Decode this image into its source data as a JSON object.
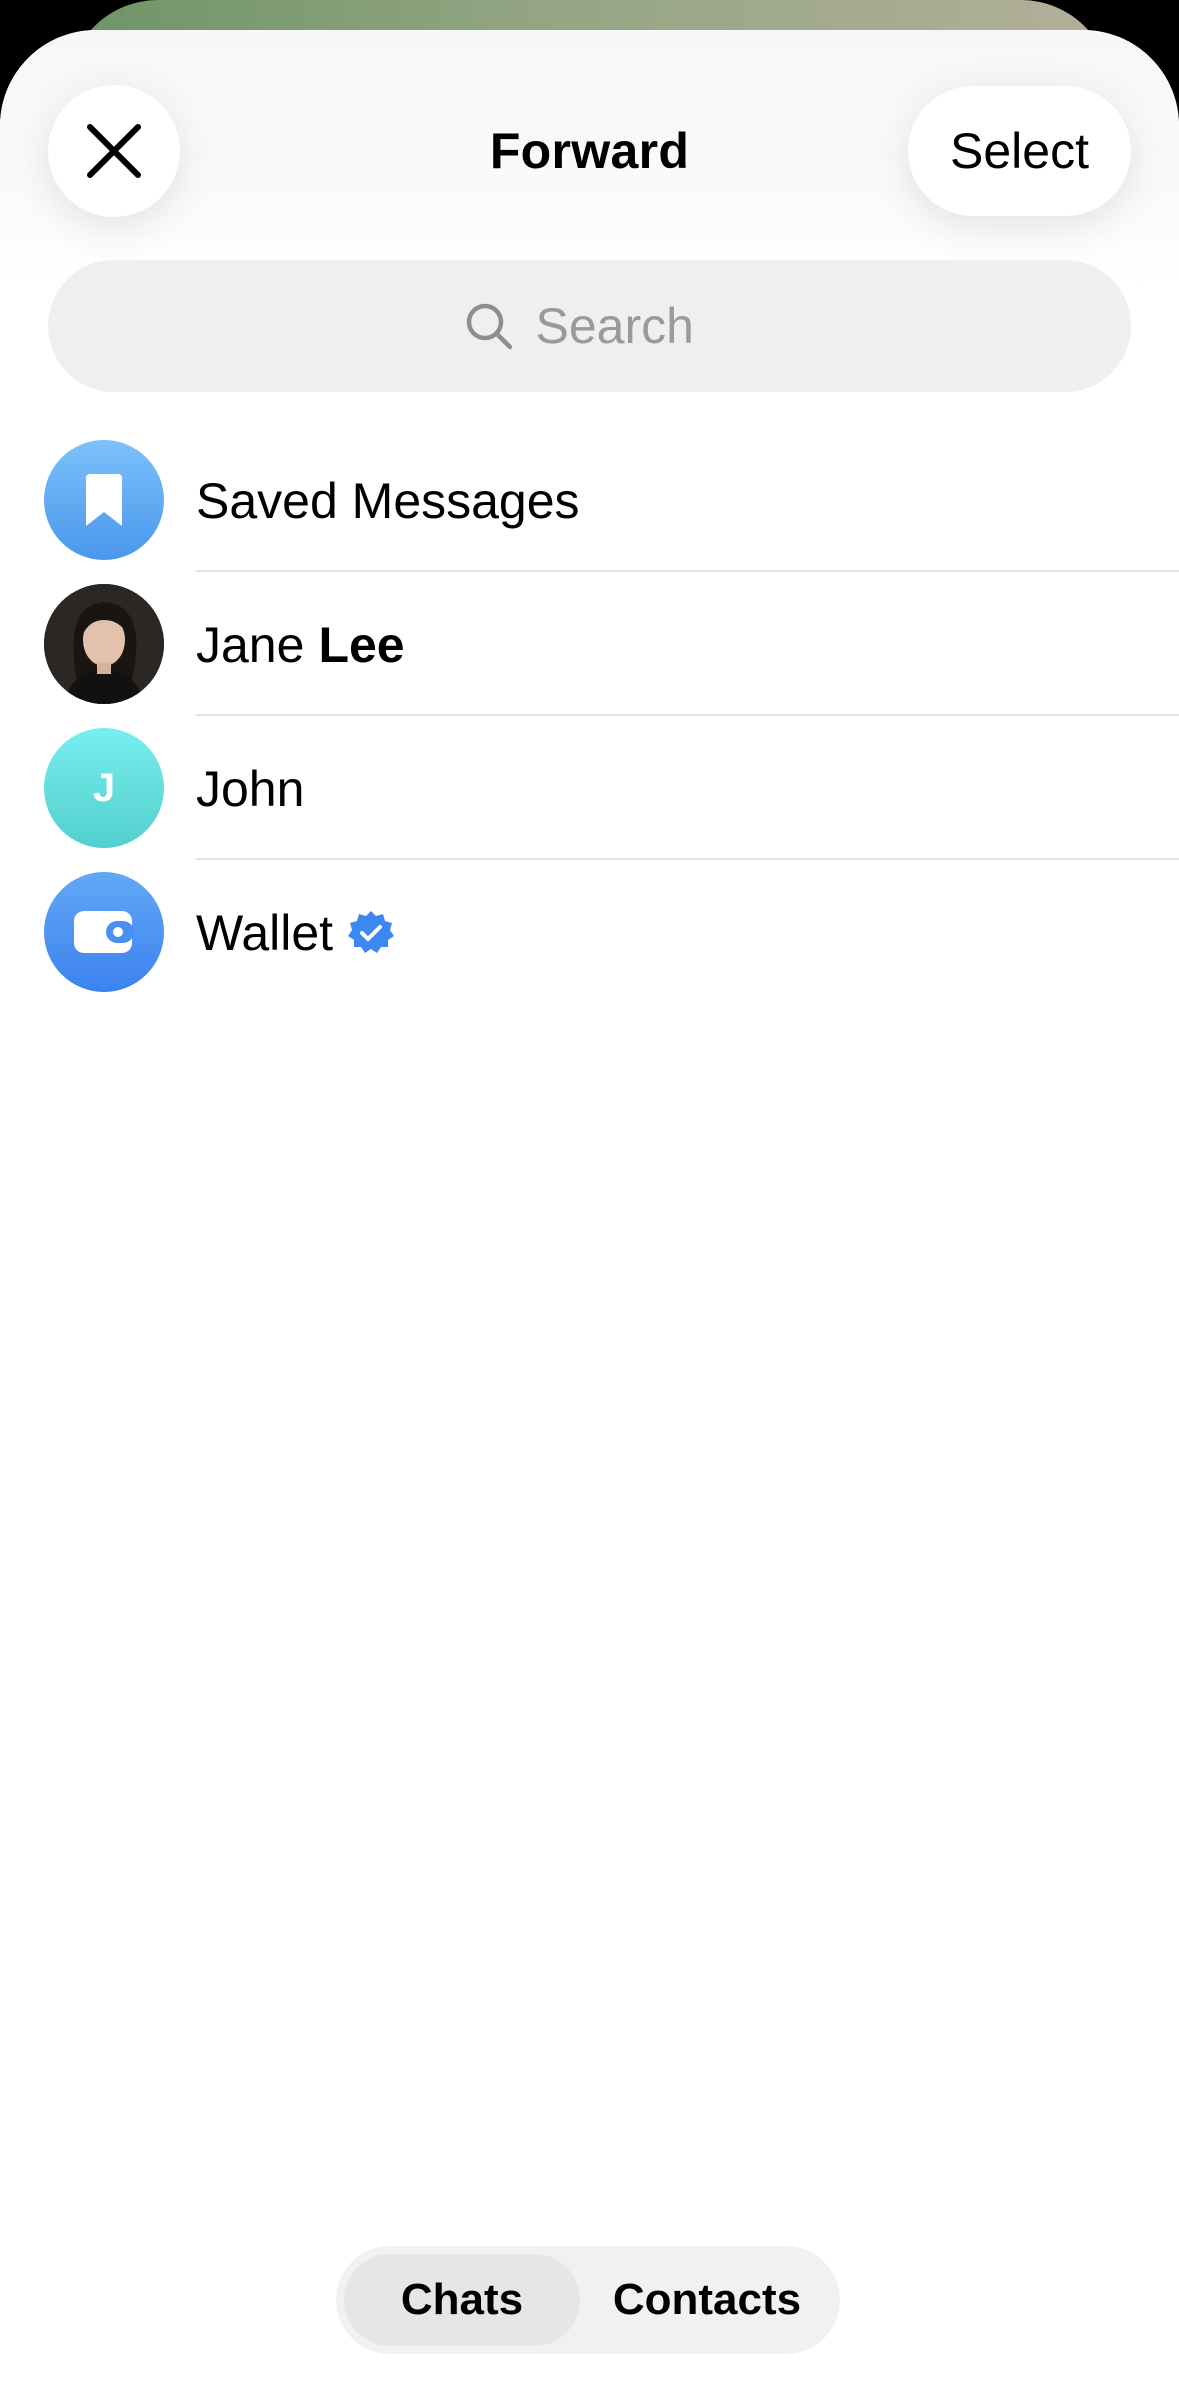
{
  "header": {
    "title": "Forward",
    "select_label": "Select"
  },
  "search": {
    "placeholder": "Search"
  },
  "chats": [
    {
      "name": "Saved Messages",
      "avatar_icon": "bookmark-icon"
    },
    {
      "first_name": "Jane",
      "last_name": "Lee",
      "avatar": "photo"
    },
    {
      "name": "John",
      "initial": "J"
    },
    {
      "name": "Wallet",
      "verified": true,
      "avatar_icon": "wallet-icon"
    }
  ],
  "tabs": {
    "chats_label": "Chats",
    "contacts_label": "Contacts",
    "selected": "Chats"
  },
  "colors": {
    "verified_blue": "#3d87f2",
    "saved_blue": "#4a97ec",
    "john_teal": "#52cfcc"
  }
}
